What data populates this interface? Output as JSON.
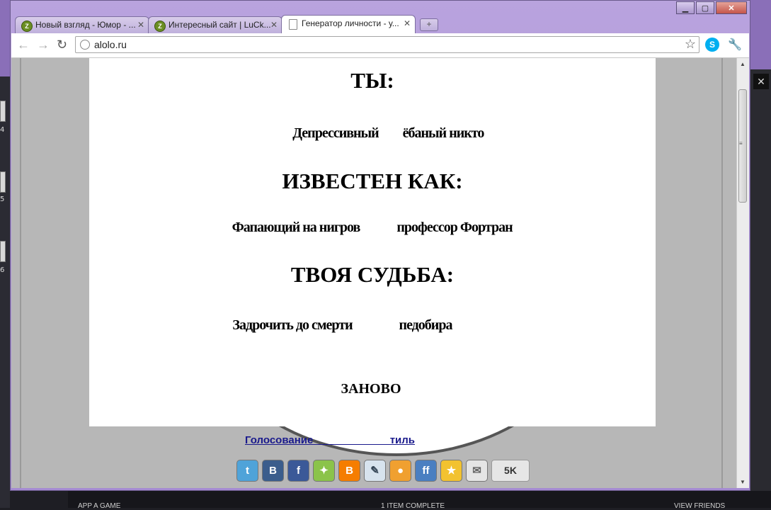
{
  "desktop": {
    "left_numbers": [
      "4",
      "5",
      "6"
    ],
    "taskbar": {
      "left": "APP A GAME",
      "center": "1 ITEM COMPLETE",
      "right": "VIEW FRIENDS"
    }
  },
  "browser": {
    "tabs": [
      {
        "title": "Новый взгляд - Юмор - ..."
      },
      {
        "title": "Интересный сайт | LuCk..."
      },
      {
        "title": "Генератор личности - у..."
      }
    ],
    "url": "alolo.ru"
  },
  "page": {
    "heading_you": "ТЫ:",
    "you_word1": "Депрессивный",
    "you_word2": "ёбаный никто",
    "heading_known": "ИЗВЕСТЕН КАК:",
    "known_word1": "Фапающий на нигров",
    "known_word2": "профессор Фортран",
    "heading_fate": "ТВОЯ СУДЬБА:",
    "fate_word1": "Задрочить до смерти",
    "fate_word2": "педобира",
    "again_button": "ЗАНОВО",
    "vote_link": "Голосование                          тиль",
    "share_count": "5K"
  }
}
